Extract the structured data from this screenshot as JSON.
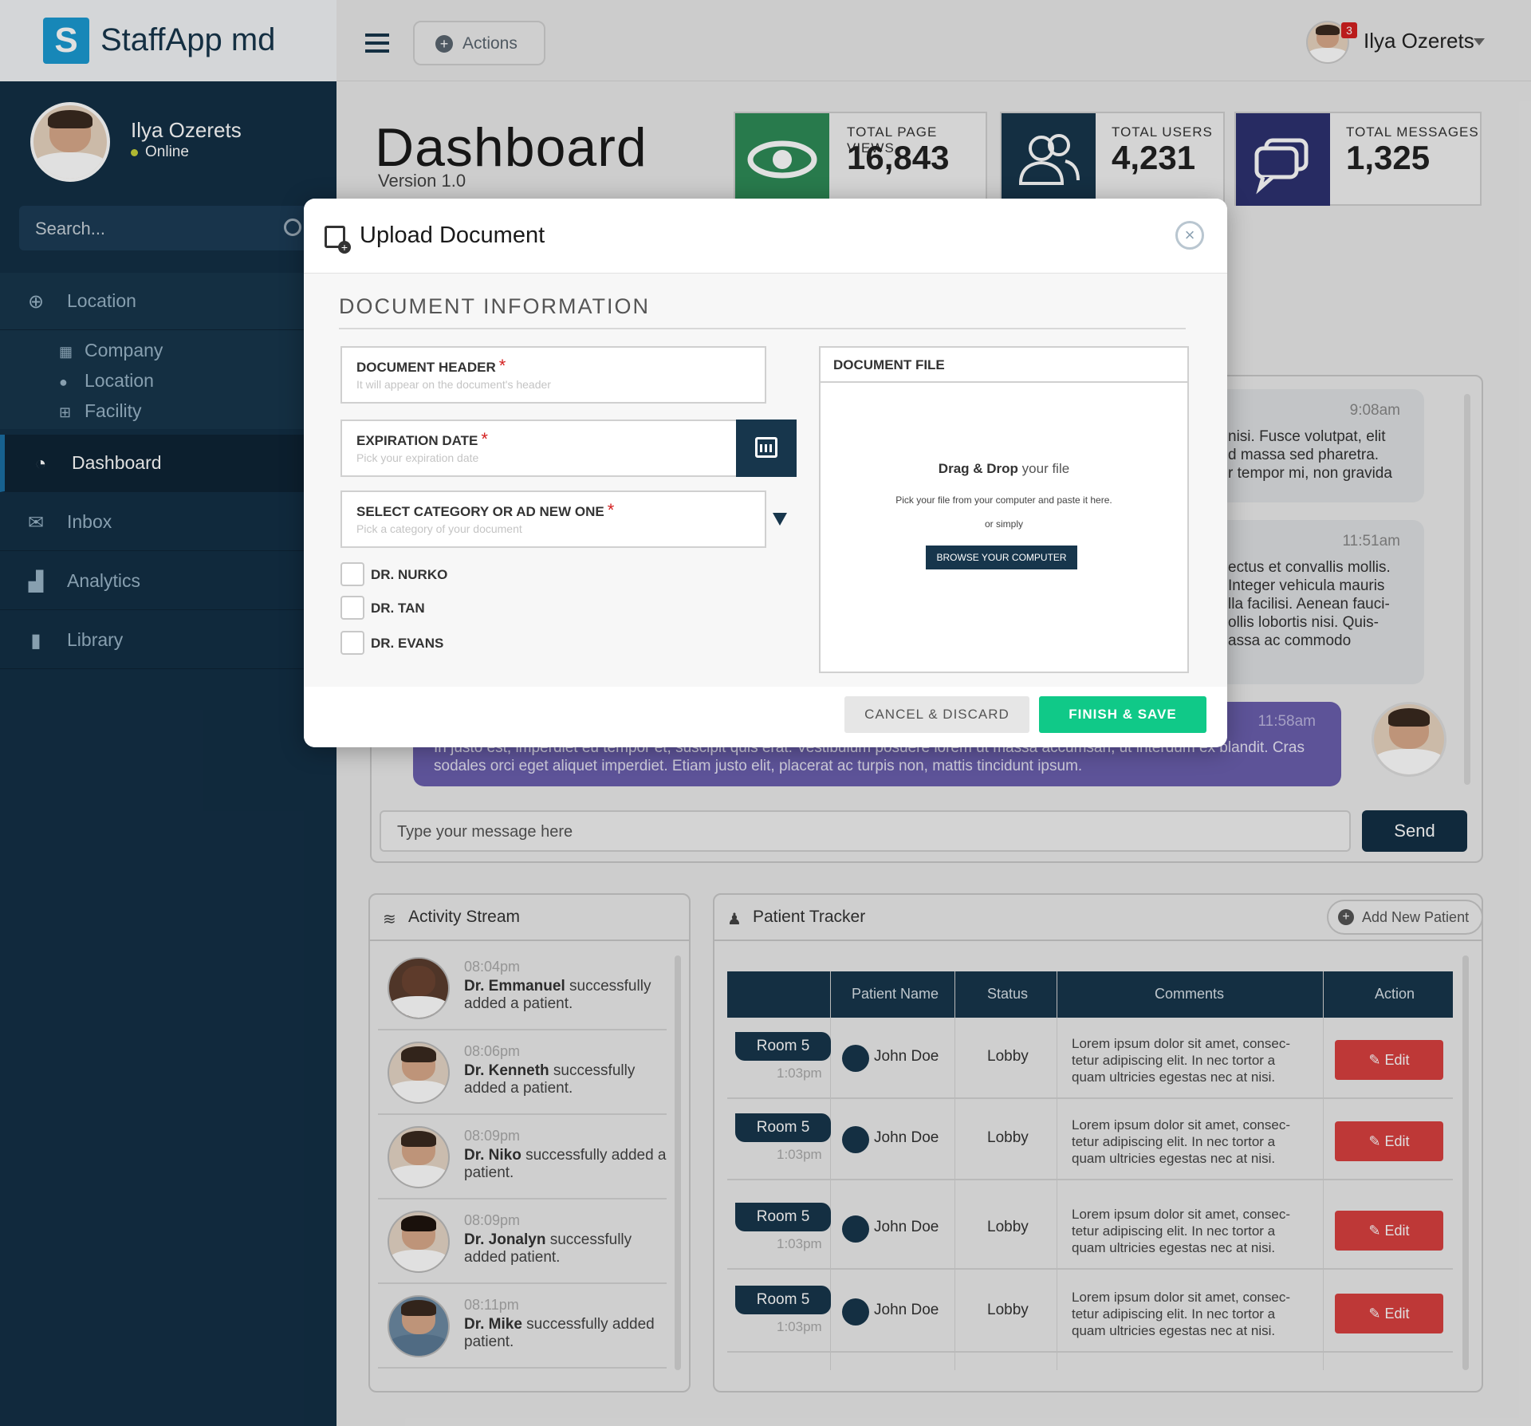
{
  "brand": {
    "name": "StaffApp md",
    "logo_letter": "S"
  },
  "profile": {
    "name": "Ilya Ozerets",
    "status": "Online"
  },
  "search": {
    "placeholder": "Search..."
  },
  "sidebar": {
    "items": [
      {
        "label": "Location",
        "icon": "crosshair-icon"
      },
      {
        "label": "Dashboard",
        "icon": "gauge-icon"
      },
      {
        "label": "Inbox",
        "icon": "envelope-icon"
      },
      {
        "label": "Analytics",
        "icon": "bar-chart-icon"
      },
      {
        "label": "Library",
        "icon": "book-icon"
      }
    ],
    "sub_items": [
      {
        "label": "Company",
        "icon": "building-icon"
      },
      {
        "label": "Location",
        "icon": "map-pin-icon"
      },
      {
        "label": "Facility",
        "icon": "hospital-icon"
      }
    ]
  },
  "topbar": {
    "actions_label": "Actions",
    "user_name": "Ilya Ozerets",
    "notification_count": "3"
  },
  "dashboard": {
    "title": "Dashboard",
    "version": "Version 1.0"
  },
  "stats": [
    {
      "label": "TOTAL PAGE VIEWS",
      "value": "16,843",
      "color": "#2e8b57",
      "icon": "eye-icon"
    },
    {
      "label": "TOTAL USERS",
      "value": "4,231",
      "color": "#17364c",
      "icon": "users-icon"
    },
    {
      "label": "TOTAL MESSAGES",
      "value": "1,325",
      "color": "#2d3170",
      "icon": "chat-icon"
    }
  ],
  "chat": {
    "messages": [
      {
        "time": "9:08am",
        "text": "nisi. Fusce volutpat, elit\nd massa sed pharetra.\nr tempor mi, non gravida"
      },
      {
        "time": "11:51am",
        "text": "ectus et convallis mollis.\nInteger vehicula mauris\nlla facilisi. Aenean fauci-\nollis lobortis nisi. Quis-\nassa ac commodo"
      },
      {
        "time": "11:58am",
        "text": "In justo est, imperdiet eu tempor et, suscipit quis erat. Vestibulum posuere lorem ut massa accumsan, ut interdum ex blandit. Cras sodales orci eget aliquet imperdiet. Etiam justo elit, placerat ac turpis non, mattis tincidunt ipsum."
      }
    ],
    "input_placeholder": "Type your message here",
    "send_label": "Send"
  },
  "activity": {
    "title": "Activity Stream",
    "items": [
      {
        "time": "08:04pm",
        "name": "Emmanuel",
        "text": "successfully added a patient."
      },
      {
        "time": "08:06pm",
        "name": "Kenneth",
        "text": "successfully added a patient."
      },
      {
        "time": "08:09pm",
        "name": "Niko",
        "text": "successfully added a patient."
      },
      {
        "time": "08:09pm",
        "name": "Jonalyn",
        "text": "successfully added patient."
      },
      {
        "time": "08:11pm",
        "name": "Mike",
        "text": "successfully added patient."
      }
    ],
    "prefix": "Dr."
  },
  "tracker": {
    "title": "Patient Tracker",
    "add_label": "Add New Patient",
    "columns": [
      "Patient Name",
      "Status",
      "Comments",
      "Action"
    ],
    "rows": [
      {
        "room": "Room 5",
        "time": "1:03pm",
        "name": "John Doe",
        "status": "Lobby",
        "comment": "Lorem ipsum dolor sit amet, consec-tetur adipiscing elit. In nec tortor a quam ultricies egestas nec at nisi.",
        "action": "Edit"
      },
      {
        "room": "Room 5",
        "time": "1:03pm",
        "name": "John Doe",
        "status": "Lobby",
        "comment": "Lorem ipsum dolor sit amet, consec-tetur adipiscing elit. In nec tortor a quam ultricies egestas nec at nisi.",
        "action": "Edit"
      },
      {
        "room": "Room 5",
        "time": "1:03pm",
        "name": "John Doe",
        "status": "Lobby",
        "comment": "Lorem ipsum dolor sit amet, consec-tetur adipiscing elit. In nec tortor a quam ultricies egestas nec at nisi.",
        "action": "Edit"
      },
      {
        "room": "Room 5",
        "time": "1:03pm",
        "name": "John Doe",
        "status": "Lobby",
        "comment": "Lorem ipsum dolor sit amet, consec-tetur adipiscing elit. In nec tortor a quam ultricies egestas nec at nisi.",
        "action": "Edit"
      }
    ]
  },
  "modal": {
    "title": "Upload Document",
    "section_title": "DOCUMENT INFORMATION",
    "fields": {
      "header": {
        "label": "DOCUMENT HEADER",
        "placeholder": "It will appear on the document's header"
      },
      "expiration": {
        "label": "EXPIRATION DATE",
        "placeholder": "Pick your expiration date"
      },
      "category": {
        "label": "SELECT CATEGORY OR AD NEW ONE",
        "placeholder": "Pick a category of your document"
      }
    },
    "required_mark": "*",
    "doctors": [
      "DR. NURKO",
      "DR. TAN",
      "DR. EVANS"
    ],
    "file": {
      "header": "DOCUMENT FILE",
      "drag_bold": "Drag & Drop",
      "drag_rest": "your file",
      "hint": "Pick your file from your computer and paste it here.",
      "or_text": "or simply",
      "browse_label": "BROWSE YOUR COMPUTER"
    },
    "cancel_label": "CANCEL & DISCARD",
    "finish_label": "FINISH & SAVE"
  }
}
